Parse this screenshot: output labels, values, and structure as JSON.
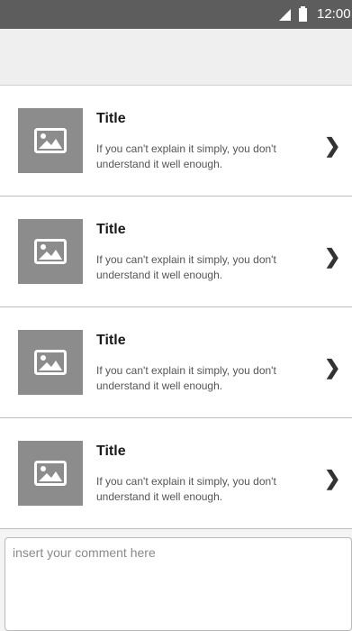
{
  "status_bar": {
    "time": "12:00",
    "signal_icon": "signal-icon",
    "battery_icon": "battery-icon"
  },
  "header": {
    "title": ""
  },
  "list": {
    "items": [
      {
        "title": "Title",
        "description": "If you can't explain it simply, you don't understand it well enough.",
        "image_icon": "image-icon",
        "chevron_icon": "chevron-right-icon"
      },
      {
        "title": "Title",
        "description": "If you can't explain it simply, you don't understand it well enough.",
        "image_icon": "image-icon",
        "chevron_icon": "chevron-right-icon"
      },
      {
        "title": "Title",
        "description": "If you can't explain it simply, you don't understand it well enough.",
        "image_icon": "image-icon",
        "chevron_icon": "chevron-right-icon"
      },
      {
        "title": "Title",
        "description": "If you can't explain it simply, you don't understand it well enough.",
        "image_icon": "image-icon",
        "chevron_icon": "chevron-right-icon"
      }
    ]
  },
  "comment": {
    "placeholder": "insert your comment here",
    "value": ""
  },
  "colors": {
    "status_bar": "#5d5d5d",
    "thumbnail": "#8c8c8c",
    "divider": "#bdbdbd"
  }
}
